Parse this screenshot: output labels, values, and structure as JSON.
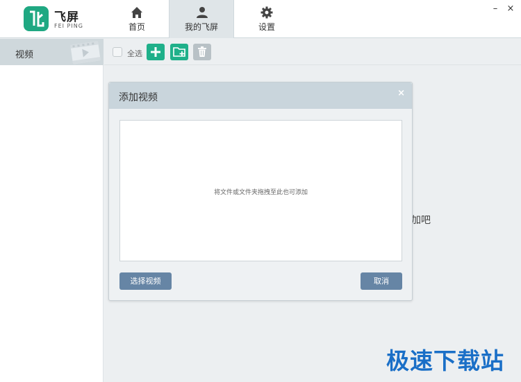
{
  "app": {
    "name": "飞屏",
    "sub_name": "FEI PING"
  },
  "nav": {
    "tabs": [
      {
        "label": "首页",
        "icon": "home-icon",
        "active": false
      },
      {
        "label": "我的飞屏",
        "icon": "user-icon",
        "active": true
      },
      {
        "label": "设置",
        "icon": "gear-icon",
        "active": false
      }
    ]
  },
  "window": {
    "minimize_glyph": "–",
    "close_glyph": "×"
  },
  "sidebar": {
    "items": [
      {
        "label": "视频",
        "icon": "film-icon",
        "selected": true
      }
    ]
  },
  "toolbar": {
    "select_all_label": "全选",
    "select_all_checked": false,
    "accent_color": "#1fb08a",
    "disabled_color": "#b8c1c6"
  },
  "background": {
    "hint_fragment": "加吧"
  },
  "dialog": {
    "title": "添加视频",
    "close_glyph": "×",
    "drop_hint": "将文件或文件夹拖拽至此也可添加",
    "select_button": "选择视频",
    "cancel_button": "取消",
    "button_color": "#6685a5"
  },
  "watermark": {
    "text": "极速下载站"
  }
}
